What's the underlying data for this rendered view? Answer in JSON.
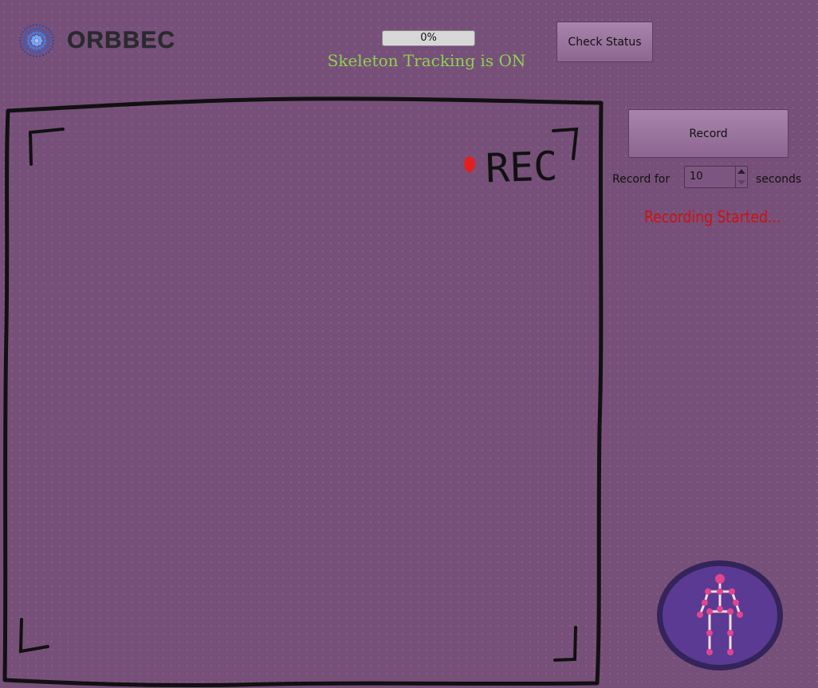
{
  "header": {
    "logo_text": "ORBBEC",
    "progress": {
      "value": 0,
      "label": "0%"
    },
    "tracking_status": "Skeleton Tracking is ON",
    "check_status_label": "Check Status"
  },
  "viewport": {
    "rec_label": "REC"
  },
  "controls": {
    "record_label": "Record",
    "record_for_label": "Record for",
    "duration_value": "10",
    "seconds_label": "seconds",
    "recording_status": "Recording Started..."
  },
  "colors": {
    "background": "#765079",
    "tracking_status": "#8fd14f",
    "recording_status": "#cc1111",
    "rec_dot": "#e02020",
    "skeleton_joint": "#e0458f"
  },
  "icons": {
    "logo": "orbbec-logo-icon",
    "skeleton": "skeleton-figure-icon"
  }
}
